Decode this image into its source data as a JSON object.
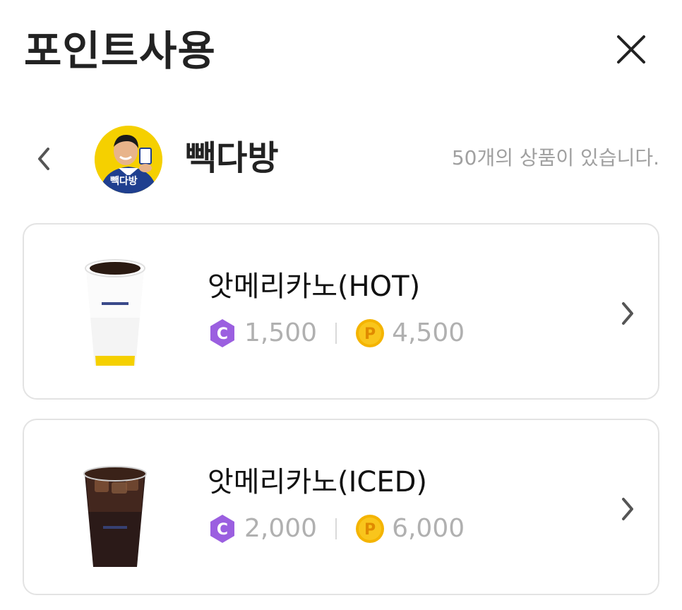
{
  "header": {
    "title": "포인트사용",
    "close_icon": "close-icon"
  },
  "brand": {
    "name": "빽다방",
    "logo_text": "빽다방",
    "product_count_text": "50개의 상품이 있습니다.",
    "back_icon": "chevron-left-icon"
  },
  "colors": {
    "coin_c": "#9b5fe0",
    "coin_p": "#f4b400",
    "price_text": "#b0b0b0",
    "card_border": "#e3e3e3",
    "logo_bg": "#f5d000",
    "logo_blue": "#1f3f8f"
  },
  "products": [
    {
      "name": "앗메리카노(HOT)",
      "c_points": "1,500",
      "p_points": "4,500",
      "coin_c_label": "C",
      "coin_p_label": "P",
      "image": "hot-coffee-cup"
    },
    {
      "name": "앗메리카노(ICED)",
      "c_points": "2,000",
      "p_points": "6,000",
      "coin_c_label": "C",
      "coin_p_label": "P",
      "image": "iced-coffee-cup"
    }
  ]
}
